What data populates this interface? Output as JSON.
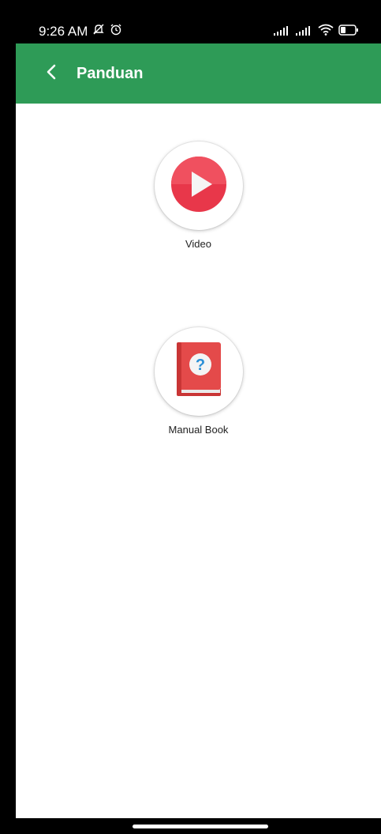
{
  "status_bar": {
    "time": "9:26 AM",
    "icons": [
      "mute-icon",
      "alarm-icon",
      "signal-icon",
      "signal-icon",
      "wifi-icon",
      "battery-icon"
    ]
  },
  "app_bar": {
    "title": "Panduan",
    "background_color": "#2e9b57",
    "back_icon": "chevron-left-icon"
  },
  "menu": {
    "items": [
      {
        "label": "Video",
        "icon": "play-video-icon",
        "color": "#e8374a"
      },
      {
        "label": "Manual Book",
        "icon": "question-book-icon",
        "color": "#e44a4a"
      }
    ]
  }
}
